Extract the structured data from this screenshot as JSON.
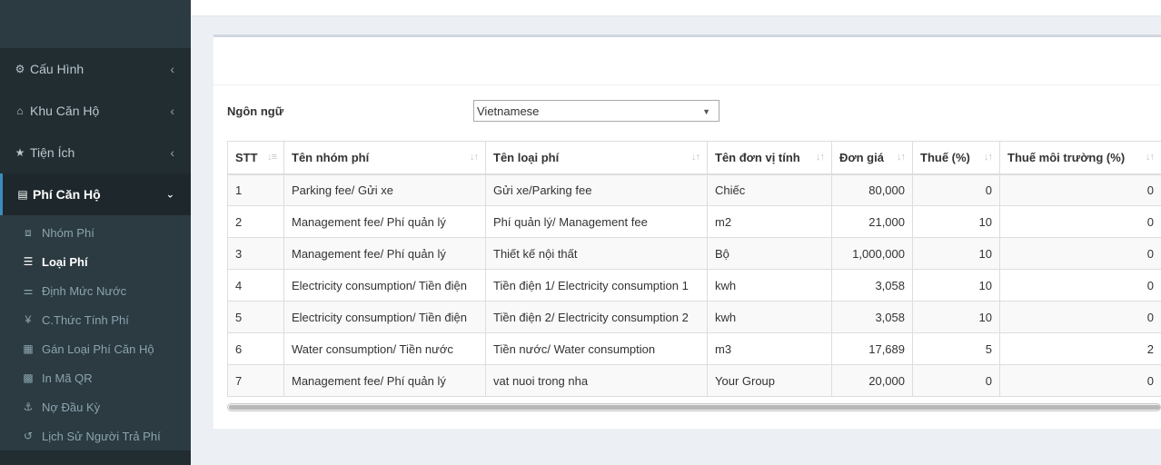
{
  "sidebar": {
    "items": [
      {
        "label": "Cấu Hình",
        "icon": "gear-icon"
      },
      {
        "label": "Khu Căn Hộ",
        "icon": "home-icon"
      },
      {
        "label": "Tiện Ích",
        "icon": "star-icon"
      },
      {
        "label": "Phí Căn Hộ",
        "icon": "building-icon"
      }
    ],
    "submenu": [
      {
        "label": "Nhóm Phí",
        "icon": "object-group-icon"
      },
      {
        "label": "Loại Phí",
        "icon": "list-icon"
      },
      {
        "label": "Định Mức Nước",
        "icon": "sliders-icon"
      },
      {
        "label": "C.Thức Tính Phí",
        "icon": "yen-icon"
      },
      {
        "label": "Gán Loại Phí Căn Hộ",
        "icon": "table-icon"
      },
      {
        "label": "In Mã QR",
        "icon": "qrcode-icon"
      },
      {
        "label": "Nợ Đầu Kỳ",
        "icon": "anchor-icon"
      },
      {
        "label": "Lịch Sử Người Trả Phí",
        "icon": "history-icon"
      }
    ]
  },
  "language": {
    "label": "Ngôn ngữ",
    "selected": "Vietnamese"
  },
  "table": {
    "headers": [
      "STT",
      "Tên nhóm phí",
      "Tên loại phí",
      "Tên đơn vị tính",
      "Đơn giá",
      "Thuế (%)",
      "Thuế môi trường (%)"
    ],
    "rows": [
      [
        "1",
        "Parking fee/ Gửi xe",
        "Gửi xe/Parking fee",
        "Chiếc",
        "80,000",
        "0",
        "0"
      ],
      [
        "2",
        "Management fee/ Phí quản lý",
        "Phí quản lý/ Management fee",
        "m2",
        "21,000",
        "10",
        "0"
      ],
      [
        "3",
        "Management fee/ Phí quản lý",
        "Thiết kế nội thất",
        "Bộ",
        "1,000,000",
        "10",
        "0"
      ],
      [
        "4",
        "Electricity consumption/ Tiền điện",
        "Tiền điện 1/ Electricity consumption 1",
        "kwh",
        "3,058",
        "10",
        "0"
      ],
      [
        "5",
        "Electricity consumption/ Tiền điện",
        "Tiền điện 2/ Electricity consumption 2",
        "kwh",
        "3,058",
        "10",
        "0"
      ],
      [
        "6",
        "Water consumption/ Tiền nước",
        "Tiền nước/ Water consumption",
        "m3",
        "17,689",
        "5",
        "2"
      ],
      [
        "7",
        "Management fee/ Phí quản lý",
        "vat nuoi trong nha",
        "Your Group",
        "20,000",
        "0",
        "0"
      ]
    ]
  },
  "colors": {
    "sidebar_bg": "#222d32",
    "submenu_bg": "#2c3b41",
    "accent": "#3c8dbc"
  }
}
